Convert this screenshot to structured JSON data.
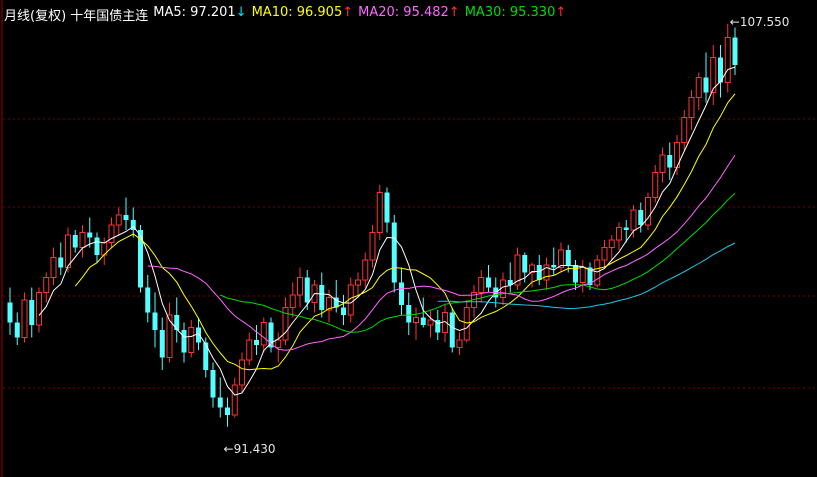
{
  "header": {
    "title": "月线(复权) 十年国债主连",
    "ma": [
      {
        "label": "MA5: 97.201",
        "arrow": "↓",
        "color": "#ffffff",
        "arrow_color": "#00e5ff"
      },
      {
        "label": "MA10: 96.905",
        "arrow": "↑",
        "color": "#ffff00",
        "arrow_color": "#ff3030"
      },
      {
        "label": "MA20: 95.482",
        "arrow": "↑",
        "color": "#ff66ff",
        "arrow_color": "#ff3030"
      },
      {
        "label": "MA30: 95.330",
        "arrow": "↑",
        "color": "#00dd00",
        "arrow_color": "#ff3030"
      }
    ]
  },
  "markers": {
    "high": "107.550",
    "low": "91.430"
  },
  "colors": {
    "up": "#ff3232",
    "down": "#54ffff",
    "grid": "#7a0000",
    "axis": "#aa0000"
  },
  "chart_data": {
    "type": "candlestick",
    "title": "月线(复权) 十年国债主连",
    "ylim": [
      91.0,
      108.0
    ],
    "high": 107.55,
    "low": 91.43,
    "candles": [
      [
        96.4,
        97.0,
        95.1,
        95.6
      ],
      [
        95.6,
        96.0,
        94.7,
        95.0
      ],
      [
        95.0,
        96.8,
        94.8,
        96.5
      ],
      [
        96.5,
        97.0,
        95.0,
        95.5
      ],
      [
        95.5,
        97.0,
        95.2,
        96.8
      ],
      [
        96.8,
        97.6,
        96.4,
        97.4
      ],
      [
        97.4,
        98.6,
        97.1,
        98.2
      ],
      [
        98.2,
        98.8,
        97.5,
        97.8
      ],
      [
        97.8,
        99.4,
        97.6,
        99.1
      ],
      [
        99.1,
        99.3,
        98.4,
        98.6
      ],
      [
        98.6,
        99.5,
        98.2,
        99.2
      ],
      [
        99.2,
        99.8,
        98.6,
        99.0
      ],
      [
        99.0,
        99.2,
        98.0,
        98.3
      ],
      [
        98.3,
        99.0,
        97.9,
        98.8
      ],
      [
        98.8,
        99.8,
        98.6,
        99.5
      ],
      [
        99.5,
        100.2,
        99.1,
        99.9
      ],
      [
        99.9,
        100.6,
        99.3,
        99.7
      ],
      [
        99.7,
        100.2,
        99.0,
        99.3
      ],
      [
        99.3,
        99.5,
        96.8,
        97.0
      ],
      [
        97.0,
        97.5,
        95.6,
        96.0
      ],
      [
        96.0,
        96.8,
        94.6,
        95.3
      ],
      [
        95.3,
        95.8,
        93.7,
        94.2
      ],
      [
        94.2,
        96.4,
        94.0,
        95.9
      ],
      [
        95.9,
        96.6,
        94.8,
        95.3
      ],
      [
        95.3,
        95.6,
        94.0,
        94.4
      ],
      [
        94.4,
        95.7,
        94.2,
        95.4
      ],
      [
        95.4,
        95.8,
        94.5,
        94.8
      ],
      [
        94.8,
        95.0,
        93.4,
        93.7
      ],
      [
        93.7,
        94.0,
        92.2,
        92.6
      ],
      [
        92.6,
        93.4,
        91.8,
        92.2
      ],
      [
        92.2,
        92.6,
        91.43,
        91.9
      ],
      [
        91.9,
        93.4,
        91.8,
        93.1
      ],
      [
        93.1,
        94.4,
        92.8,
        94.1
      ],
      [
        94.1,
        95.2,
        93.9,
        94.9
      ],
      [
        94.9,
        95.5,
        94.3,
        94.7
      ],
      [
        94.7,
        95.8,
        94.4,
        95.6
      ],
      [
        95.6,
        95.8,
        94.4,
        94.6
      ],
      [
        94.6,
        95.2,
        94.0,
        94.9
      ],
      [
        94.9,
        96.6,
        94.7,
        96.2
      ],
      [
        96.2,
        97.2,
        95.8,
        96.7
      ],
      [
        96.7,
        97.8,
        96.2,
        97.4
      ],
      [
        97.4,
        97.7,
        96.1,
        96.4
      ],
      [
        96.4,
        97.3,
        96.0,
        97.1
      ],
      [
        97.1,
        97.6,
        95.8,
        96.1
      ],
      [
        96.1,
        96.9,
        95.6,
        96.6
      ],
      [
        96.6,
        97.3,
        96.0,
        96.2
      ],
      [
        96.2,
        96.7,
        95.5,
        95.9
      ],
      [
        95.9,
        97.4,
        95.6,
        97.1
      ],
      [
        97.1,
        97.6,
        96.7,
        97.3
      ],
      [
        97.3,
        98.4,
        97.0,
        98.1
      ],
      [
        98.1,
        99.5,
        97.8,
        99.2
      ],
      [
        99.2,
        101.1,
        98.9,
        100.8
      ],
      [
        100.8,
        101.0,
        99.2,
        99.6
      ],
      [
        99.6,
        99.9,
        96.8,
        97.2
      ],
      [
        97.2,
        97.8,
        95.9,
        96.3
      ],
      [
        96.3,
        96.8,
        95.1,
        95.6
      ],
      [
        95.6,
        96.2,
        94.9,
        95.8
      ],
      [
        95.8,
        96.6,
        95.4,
        95.5
      ],
      [
        95.5,
        96.1,
        95.0,
        95.7
      ],
      [
        95.7,
        96.1,
        94.9,
        95.2
      ],
      [
        95.2,
        96.3,
        94.8,
        96.0
      ],
      [
        96.0,
        96.2,
        94.4,
        94.6
      ],
      [
        94.6,
        95.2,
        94.3,
        94.9
      ],
      [
        94.9,
        96.5,
        94.8,
        96.2
      ],
      [
        96.2,
        97.1,
        95.8,
        96.8
      ],
      [
        96.8,
        97.7,
        96.4,
        97.4
      ],
      [
        97.4,
        97.9,
        96.8,
        97.0
      ],
      [
        97.0,
        97.4,
        96.2,
        96.6
      ],
      [
        96.6,
        97.6,
        96.3,
        97.3
      ],
      [
        97.3,
        98.0,
        96.8,
        97.1
      ],
      [
        97.1,
        98.6,
        96.9,
        98.3
      ],
      [
        98.3,
        98.4,
        97.2,
        97.6
      ],
      [
        97.6,
        98.0,
        97.0,
        97.9
      ],
      [
        97.9,
        98.3,
        97.1,
        97.3
      ],
      [
        97.3,
        98.2,
        96.9,
        97.9
      ],
      [
        97.9,
        98.6,
        97.5,
        97.8
      ],
      [
        97.8,
        98.8,
        97.6,
        98.5
      ],
      [
        98.5,
        98.7,
        97.6,
        97.9
      ],
      [
        97.9,
        98.1,
        96.9,
        97.2
      ],
      [
        97.2,
        98.1,
        96.8,
        97.8
      ],
      [
        97.8,
        98.0,
        96.9,
        97.1
      ],
      [
        97.1,
        98.3,
        97.0,
        98.1
      ],
      [
        98.1,
        98.9,
        97.8,
        98.6
      ],
      [
        98.6,
        99.1,
        98.1,
        98.9
      ],
      [
        98.9,
        99.6,
        98.5,
        99.4
      ],
      [
        99.4,
        99.7,
        98.8,
        99.3
      ],
      [
        99.3,
        100.3,
        99.0,
        100.1
      ],
      [
        100.1,
        100.4,
        99.2,
        99.5
      ],
      [
        99.5,
        100.8,
        99.3,
        100.6
      ],
      [
        100.6,
        101.9,
        100.4,
        101.6
      ],
      [
        101.6,
        102.6,
        101.2,
        102.3
      ],
      [
        102.3,
        102.8,
        101.3,
        101.8
      ],
      [
        101.8,
        103.1,
        101.5,
        102.8
      ],
      [
        102.8,
        104.1,
        102.5,
        103.8
      ],
      [
        103.8,
        104.9,
        103.3,
        104.6
      ],
      [
        104.6,
        105.6,
        104.1,
        105.4
      ],
      [
        105.4,
        106.4,
        104.4,
        104.8
      ],
      [
        104.8,
        106.7,
        104.3,
        106.2
      ],
      [
        106.2,
        106.7,
        104.6,
        105.2
      ],
      [
        105.2,
        107.55,
        104.8,
        107.0
      ],
      [
        107.0,
        107.4,
        105.5,
        105.9
      ]
    ]
  }
}
